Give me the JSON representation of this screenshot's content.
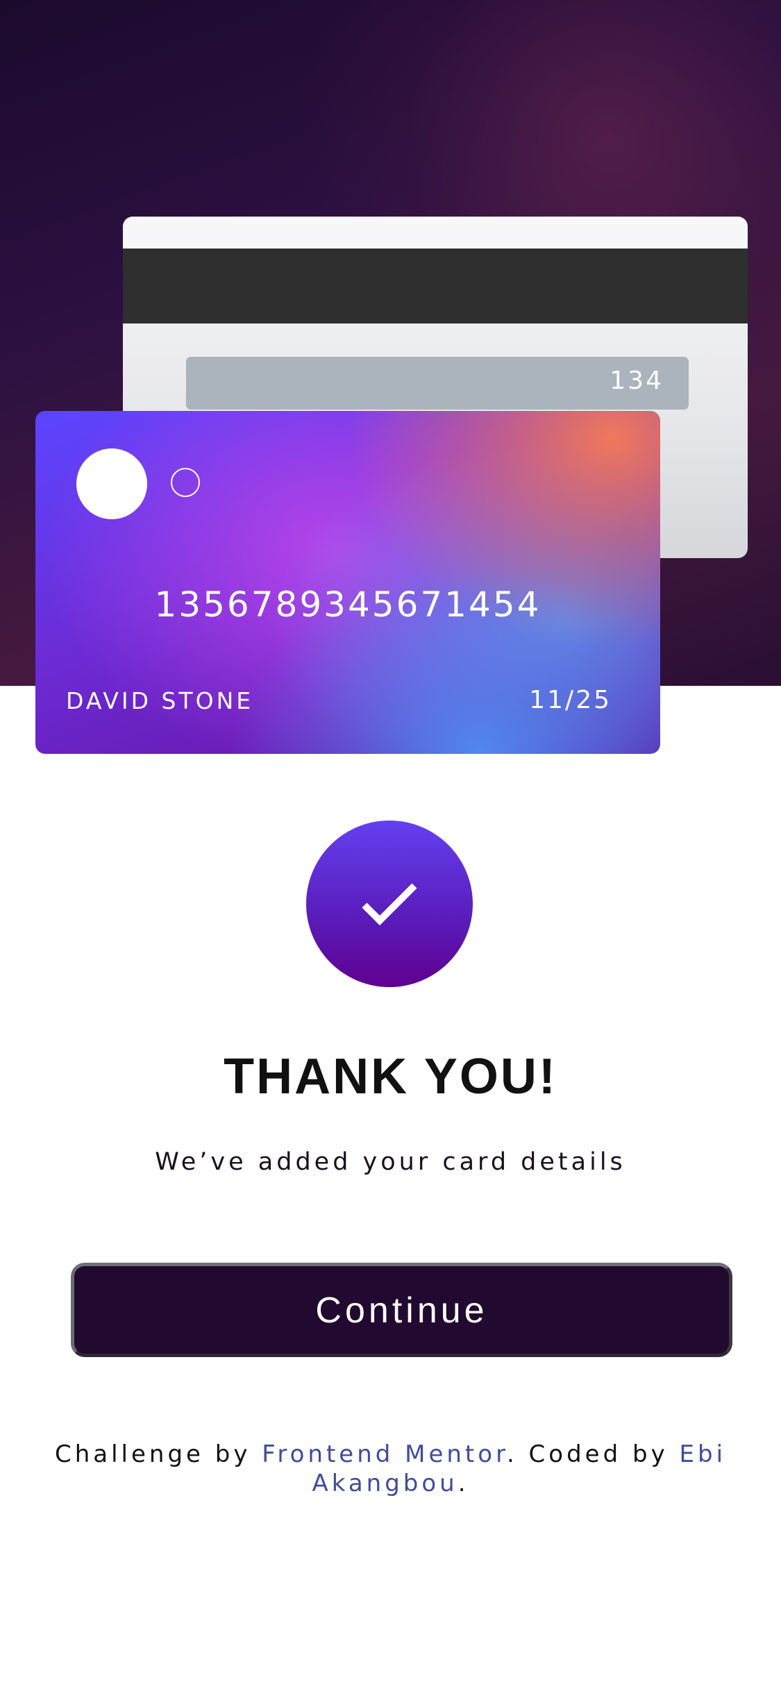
{
  "card_back": {
    "cvc": "134"
  },
  "card_front": {
    "number": "1356789345671454",
    "holder_name": "DAVID STONE",
    "expiry": "11/25"
  },
  "confirmation": {
    "icon": "check-icon",
    "title": "THANK YOU!",
    "message": "We’ve added your card details"
  },
  "actions": {
    "continue_label": "Continue"
  },
  "footer": {
    "challenge_prefix": "Challenge by ",
    "challenge_link": "Frontend Mentor",
    "coded_prefix": ". Coded by ",
    "author_link": "Ebi Akangbou",
    "suffix": "."
  },
  "colors": {
    "hero_background": "#2b1040",
    "button_background": "#220930",
    "link": "#3e4b9e",
    "check_circle_top": "#6440f0",
    "check_circle_bottom": "#600090"
  }
}
